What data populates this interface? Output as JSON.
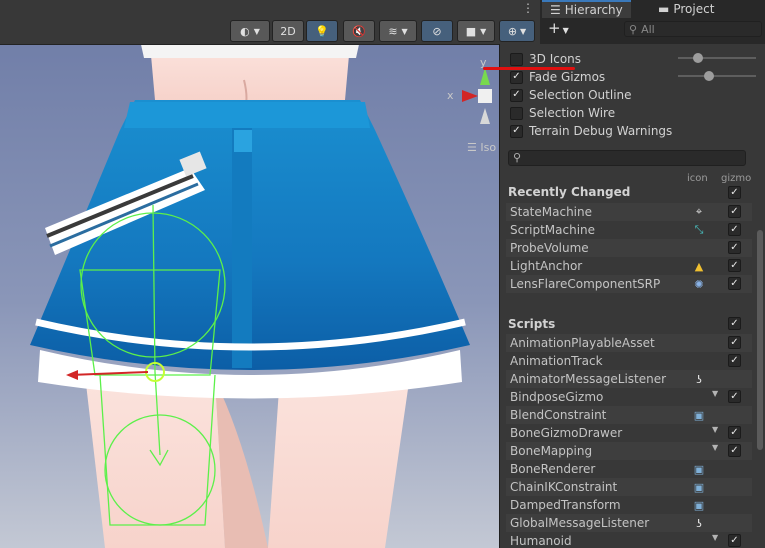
{
  "toolbar": {
    "btn_2d": "2D",
    "iso_label": "Iso"
  },
  "tabs": {
    "hierarchy": "Hierarchy",
    "project": "Project",
    "search_placeholder": "All",
    "add_label": "+"
  },
  "gizmo_axes": {
    "y": "y",
    "x": "x"
  },
  "gizmos_menu": {
    "options": [
      {
        "label": "3D Icons",
        "checked": false
      },
      {
        "label": "Fade Gizmos",
        "checked": true
      },
      {
        "label": "Selection Outline",
        "checked": true
      },
      {
        "label": "Selection Wire",
        "checked": false
      },
      {
        "label": "Terrain Debug Warnings",
        "checked": true
      }
    ],
    "icon_size_level": 0.25,
    "fade_level": 0.4,
    "col_icon": "icon",
    "col_gizmo": "gizmo",
    "recent_title": "Recently Changed",
    "recent": [
      {
        "name": "StateMachine",
        "icon": "crosshair-icon",
        "gizmo": true
      },
      {
        "name": "ScriptMachine",
        "icon": "graph-icon",
        "gizmo": true
      },
      {
        "name": "ProbeVolume",
        "icon": "",
        "gizmo": true
      },
      {
        "name": "LightAnchor",
        "icon": "light-anchor-icon",
        "gizmo": true
      },
      {
        "name": "LensFlareComponentSRP",
        "icon": "lens-flare-icon",
        "gizmo": true
      }
    ],
    "scripts_title": "Scripts",
    "scripts": [
      {
        "name": "AnimationPlayableAsset",
        "icon": "",
        "dropdown": false,
        "gizmo": true
      },
      {
        "name": "AnimationTrack",
        "icon": "",
        "dropdown": false,
        "gizmo": true
      },
      {
        "name": "AnimatorMessageListener",
        "icon": "ear-icon",
        "dropdown": false,
        "gizmo": false
      },
      {
        "name": "BindposeGizmo",
        "icon": "",
        "dropdown": true,
        "gizmo": true
      },
      {
        "name": "BlendConstraint",
        "icon": "script-icon",
        "dropdown": false,
        "gizmo": false
      },
      {
        "name": "BoneGizmoDrawer",
        "icon": "",
        "dropdown": true,
        "gizmo": true
      },
      {
        "name": "BoneMapping",
        "icon": "",
        "dropdown": true,
        "gizmo": true
      },
      {
        "name": "BoneRenderer",
        "icon": "script-icon",
        "dropdown": false,
        "gizmo": false
      },
      {
        "name": "ChainIKConstraint",
        "icon": "script-icon",
        "dropdown": false,
        "gizmo": false
      },
      {
        "name": "DampedTransform",
        "icon": "script-icon",
        "dropdown": false,
        "gizmo": false
      },
      {
        "name": "GlobalMessageListener",
        "icon": "ear-icon",
        "dropdown": false,
        "gizmo": false
      },
      {
        "name": "Humanoid",
        "icon": "",
        "dropdown": true,
        "gizmo": true
      }
    ]
  }
}
